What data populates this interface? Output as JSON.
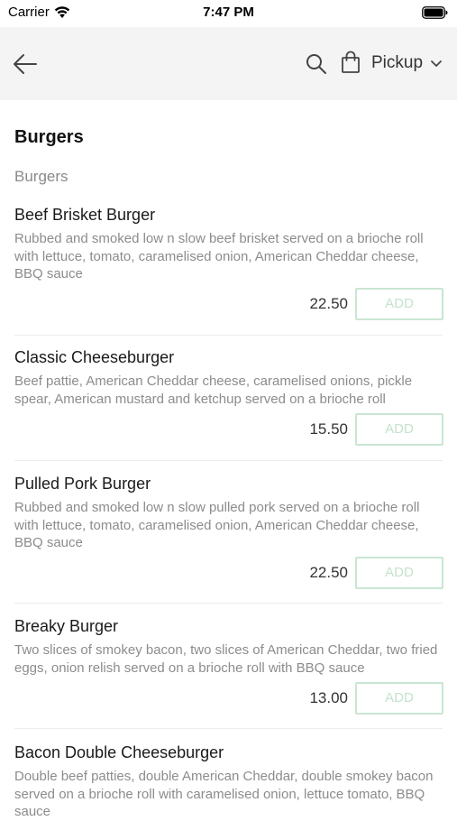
{
  "status": {
    "carrier": "Carrier",
    "time": "7:47 PM"
  },
  "nav": {
    "pickup_label": "Pickup",
    "icons": [
      "back-arrow-icon",
      "search-icon",
      "shopping-bag-icon",
      "chevron-down-icon"
    ]
  },
  "category": {
    "title": "Burgers",
    "subtitle": "Burgers"
  },
  "items": [
    {
      "name": "Beef Brisket Burger",
      "description": "Rubbed and smoked low n slow beef brisket served on a brioche roll with lettuce, tomato, caramelised onion, American Cheddar cheese, BBQ sauce",
      "price": "22.50",
      "add_label": "ADD"
    },
    {
      "name": "Classic Cheeseburger",
      "description": "Beef pattie, American Cheddar cheese, caramelised onions, pickle spear, American mustard and ketchup served on a brioche roll",
      "price": "15.50",
      "add_label": "ADD"
    },
    {
      "name": "Pulled Pork Burger",
      "description": "Rubbed and smoked low n slow pulled pork served on a brioche roll with lettuce, tomato, caramelised onion, American Cheddar cheese, BBQ sauce",
      "price": "22.50",
      "add_label": "ADD"
    },
    {
      "name": "Breaky Burger",
      "description": "Two slices of smokey bacon, two slices of American Cheddar, two fried eggs, onion relish served on a brioche roll with BBQ sauce",
      "price": "13.00",
      "add_label": "ADD"
    },
    {
      "name": "Bacon Double Cheeseburger",
      "description": "Double beef patties, double American Cheddar, double smokey bacon served on a brioche roll with caramelised onion, lettuce tomato, BBQ sauce",
      "price": "",
      "add_label": ""
    }
  ],
  "colors": {
    "nav_background": "#f4f4f4",
    "add_button_border": "#c9e6d2",
    "add_button_text": "#c4e2cc",
    "description_text": "#8c8c8c"
  }
}
